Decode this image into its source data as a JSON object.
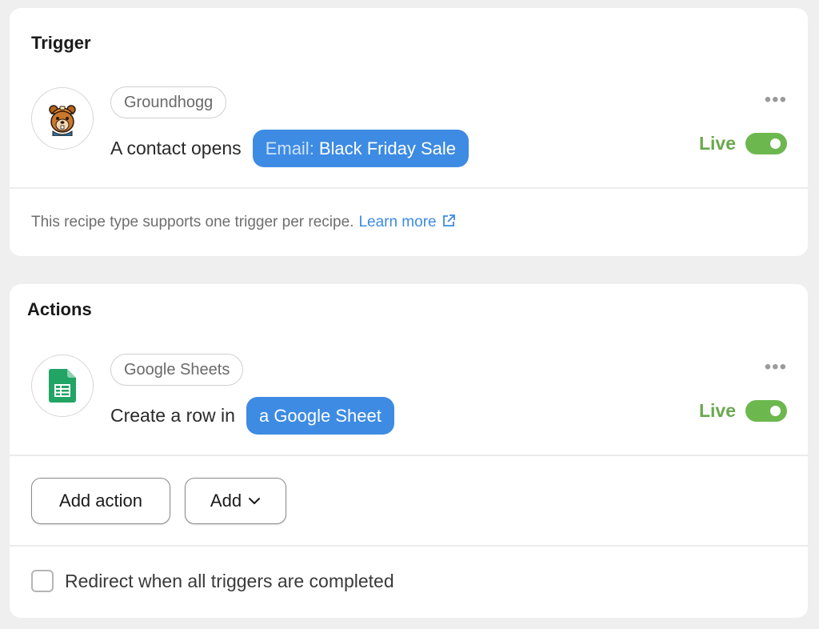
{
  "trigger": {
    "title": "Trigger",
    "integration": "Groundhogg",
    "sentence_prefix": "A contact opens",
    "token_prefix": "Email:",
    "token_value": "Black Friday Sale",
    "status": "Live",
    "note": "This recipe type supports one trigger per recipe.",
    "learn_more": "Learn more"
  },
  "actions": {
    "title": "Actions",
    "integration": "Google Sheets",
    "sentence_prefix": "Create a row in",
    "token_value": "a Google Sheet",
    "status": "Live",
    "add_action_label": "Add action",
    "add_label": "Add",
    "redirect_label": "Redirect when all triggers are completed"
  },
  "icons": {
    "trigger_logo": "groundhog-mascot-icon",
    "action_logo": "google-sheets-icon",
    "more": "more-horizontal-icon",
    "external": "external-link-icon",
    "dropdown": "chevron-down-icon"
  },
  "colors": {
    "token_blue": "#3d8be3",
    "live_green": "#6aa84f",
    "toggle_green": "#6cb84f",
    "sheets_green": "#21a464"
  }
}
